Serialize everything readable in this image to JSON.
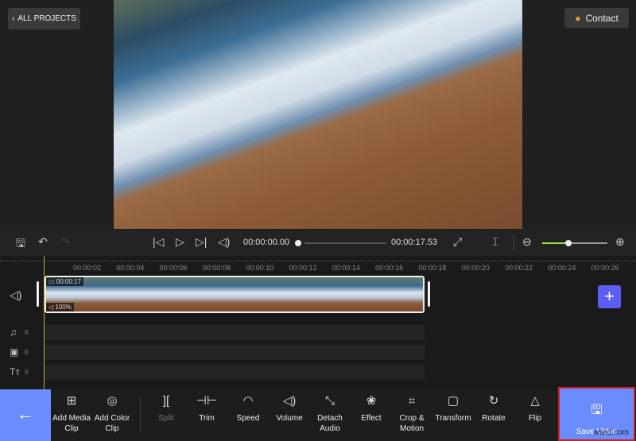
{
  "header": {
    "back_label": "ALL PROJECTS",
    "contact_label": "Contact"
  },
  "player": {
    "current_time": "00:00:00.00",
    "total_time": "00:00:17.53",
    "progress": 0,
    "zoom_level": 0.4
  },
  "ruler": [
    "00:00:02",
    "00:00:04",
    "00:00:06",
    "00:00:08",
    "00:00:10",
    "00:00:12",
    "00:00:14",
    "00:00:16",
    "00:00:18",
    "00:00:20",
    "00:00:22",
    "00:00:24",
    "00:00:26"
  ],
  "clip": {
    "duration": "00:00:17",
    "volume": "100%"
  },
  "lanes": [
    {
      "icon": "♫",
      "count": "0"
    },
    {
      "icon": "▣",
      "count": "0"
    },
    {
      "icon": "Tт",
      "count": "0"
    }
  ],
  "tools": [
    {
      "label": "Add Media Clip",
      "icon": "⊞",
      "disabled": false
    },
    {
      "label": "Add Color Clip",
      "icon": "◎",
      "disabled": false
    },
    {
      "label": "Split",
      "icon": "][",
      "disabled": true
    },
    {
      "label": "Trim",
      "icon": "⊣⊢",
      "disabled": false
    },
    {
      "label": "Speed",
      "icon": "◠",
      "disabled": false
    },
    {
      "label": "Volume",
      "icon": "◁)",
      "disabled": false
    },
    {
      "label": "Detach Audio",
      "icon": "⤡",
      "disabled": false
    },
    {
      "label": "Effect",
      "icon": "❀",
      "disabled": false
    },
    {
      "label": "Crop & Motion",
      "icon": "⌗",
      "disabled": false
    },
    {
      "label": "Transform",
      "icon": "▢",
      "disabled": false
    },
    {
      "label": "Rotate",
      "icon": "↻",
      "disabled": false
    },
    {
      "label": "Flip",
      "icon": "△",
      "disabled": false
    }
  ],
  "save_label": "Save Video",
  "watermark": "wtvid.com",
  "colors": {
    "accent": "#6b8cff",
    "add": "#5b5ef0",
    "highlight": "#d02020"
  }
}
